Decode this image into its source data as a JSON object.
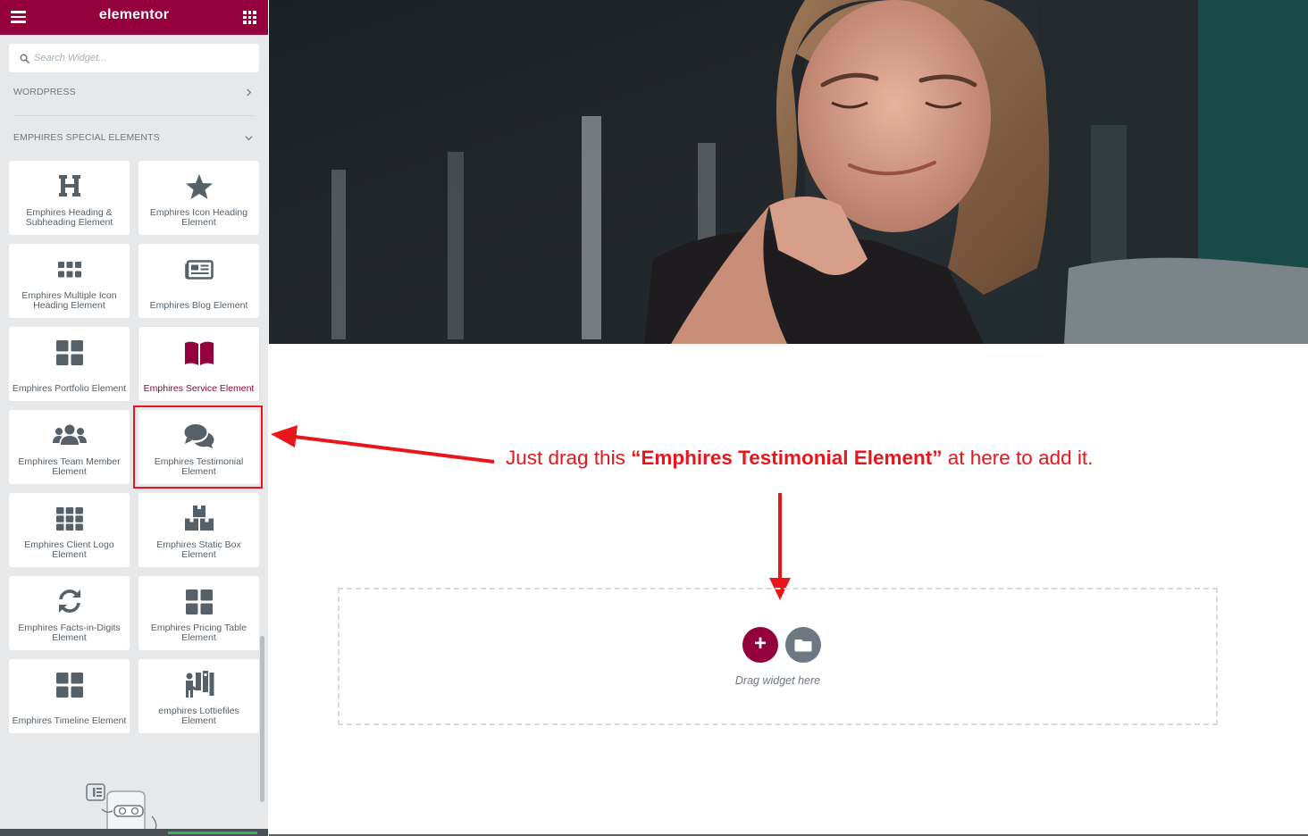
{
  "panel": {
    "brand": "elementor",
    "search": {
      "placeholder": "Search Widget..."
    },
    "categories": [
      {
        "label": "WORDPRESS",
        "state": "collapsed"
      },
      {
        "label": "EMPHIRES SPECIAL ELEMENTS",
        "state": "expanded"
      }
    ],
    "widgets": [
      {
        "label": "Emphires Heading & Subheading Element",
        "icon": "heading-icon"
      },
      {
        "label": "Emphires Icon Heading Element",
        "icon": "star-icon"
      },
      {
        "label": "Emphires Multiple Icon Heading Element",
        "icon": "icon-grid-icon"
      },
      {
        "label": "Emphires Blog Element",
        "icon": "newspaper-icon"
      },
      {
        "label": "Emphires Portfolio Element",
        "icon": "portfolio-grid-icon"
      },
      {
        "label": "Emphires Service Element",
        "icon": "open-book-icon"
      },
      {
        "label": "Emphires Team Member Element",
        "icon": "users-icon"
      },
      {
        "label": "Emphires Testimonial Element",
        "icon": "comments-icon"
      },
      {
        "label": "Emphires Client Logo Element",
        "icon": "logo-grid-icon"
      },
      {
        "label": "Emphires Static Box Element",
        "icon": "boxes-icon"
      },
      {
        "label": "Emphires Facts-in-Digits Element",
        "icon": "sync-icon"
      },
      {
        "label": "Emphires Pricing Table Element",
        "icon": "table-grid-icon"
      },
      {
        "label": "Emphires Timeline Element",
        "icon": "timeline-grid-icon"
      },
      {
        "label": "emphires Lottiefiles Element",
        "icon": "lottie-icon"
      }
    ],
    "active_widget": "Emphires Service Element"
  },
  "annotation": {
    "prefix": "Just drag this ",
    "emphasis": "“Emphires Testimonial Element”",
    "suffix": " at here to add it."
  },
  "dropzone": {
    "add_symbol": "+",
    "text": "Drag widget here"
  },
  "colors": {
    "brand": "#93003c",
    "annotation": "#e8151b",
    "panel_bg": "#e6e8ea",
    "icon": "#556068"
  }
}
